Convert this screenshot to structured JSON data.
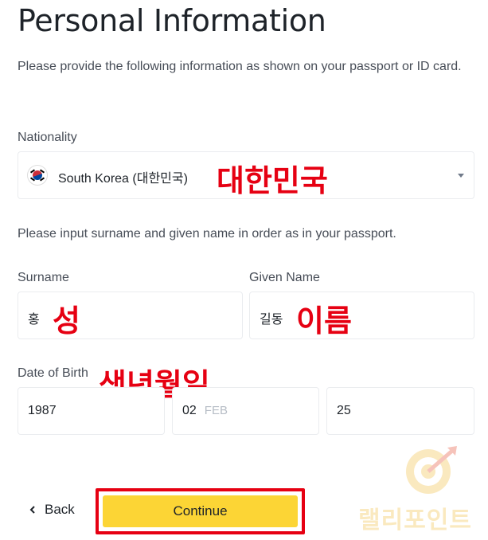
{
  "header": {
    "title": "Personal Information",
    "intro": "Please provide the following information as shown on your passport or ID card."
  },
  "nationality": {
    "label": "Nationality",
    "value": "South Korea (대한민국)",
    "annotation": "대한민국"
  },
  "name_section": {
    "instruction": "Please input surname and given name in order as in your passport.",
    "surname": {
      "label": "Surname",
      "value": "홍",
      "annotation": "성"
    },
    "given_name": {
      "label": "Given Name",
      "value": "길동",
      "annotation": "이름"
    }
  },
  "dob": {
    "label": "Date of Birth",
    "annotation": "생년월일",
    "year": "1987",
    "month": "02",
    "month_hint": "FEB",
    "day": "25"
  },
  "footer": {
    "back_label": "Back",
    "continue_label": "Continue"
  },
  "watermark": {
    "text": "랠리포인트"
  },
  "colors": {
    "accent": "#fcd535",
    "annotation": "#e60012"
  }
}
